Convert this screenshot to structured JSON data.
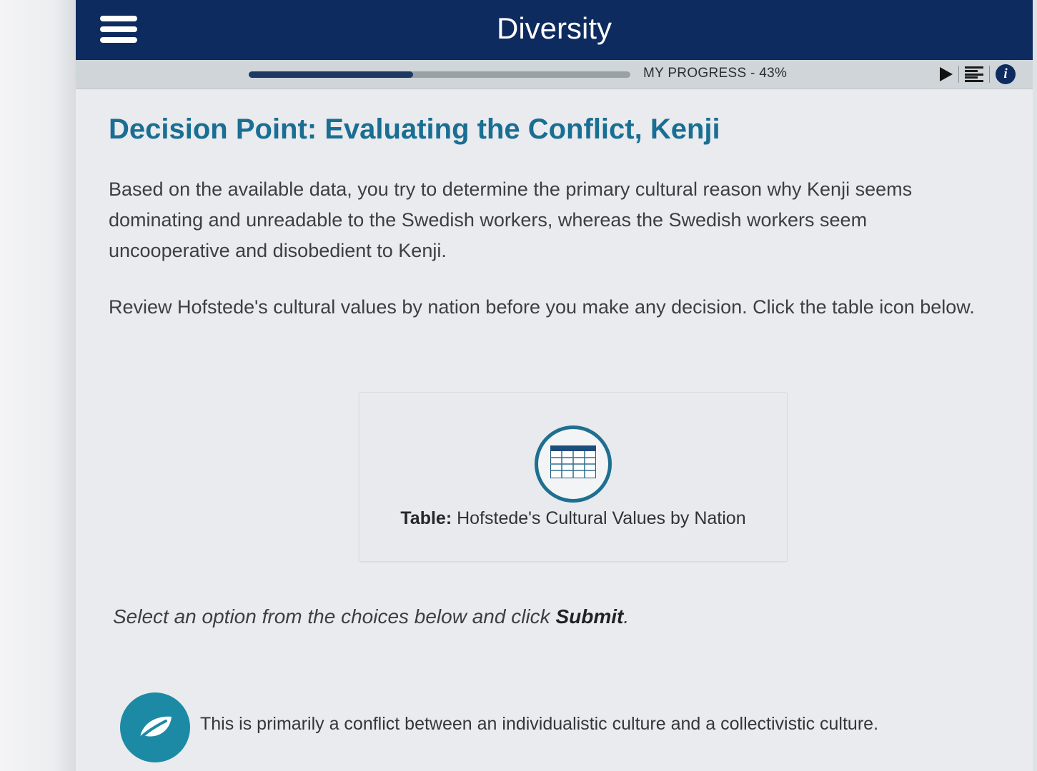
{
  "header": {
    "title": "Diversity",
    "menu_icon": "hamburger-menu-icon"
  },
  "progress": {
    "label": "MY PROGRESS - 43%",
    "value_percent": 43
  },
  "controls": {
    "icons": [
      "play-icon",
      "list-icon",
      "info-icon"
    ],
    "info_glyph": "i"
  },
  "main": {
    "title": "Decision Point: Evaluating the Conflict, Kenji",
    "paragraphs": [
      "Based on the available data, you try to determine the primary cultural reason why Kenji seems dominating and unreadable to the Swedish workers, whereas the Swedish workers seem uncooperative and disobedient to Kenji.",
      "Review Hofstede's cultural values by nation before you make any decision. Click the table icon below."
    ],
    "table_card": {
      "icon": "table-icon",
      "caption_prefix": "Table:",
      "caption_text": "Hofstede's Cultural Values by Nation"
    },
    "instruction": {
      "text": "Select an option from the choices below and click",
      "emphasis": "Submit",
      "end": "."
    },
    "options": [
      {
        "icon": "leaf-icon",
        "text": "This is primarily a conflict between an individualistic culture and a collectivistic culture."
      }
    ]
  },
  "colors": {
    "header_bg": "#0d2b5e",
    "title_blue": "#1a6e93",
    "progress_fill": "#1c3a64",
    "option_teal": "#1d8aa5",
    "table_ring": "#1e6f90"
  }
}
